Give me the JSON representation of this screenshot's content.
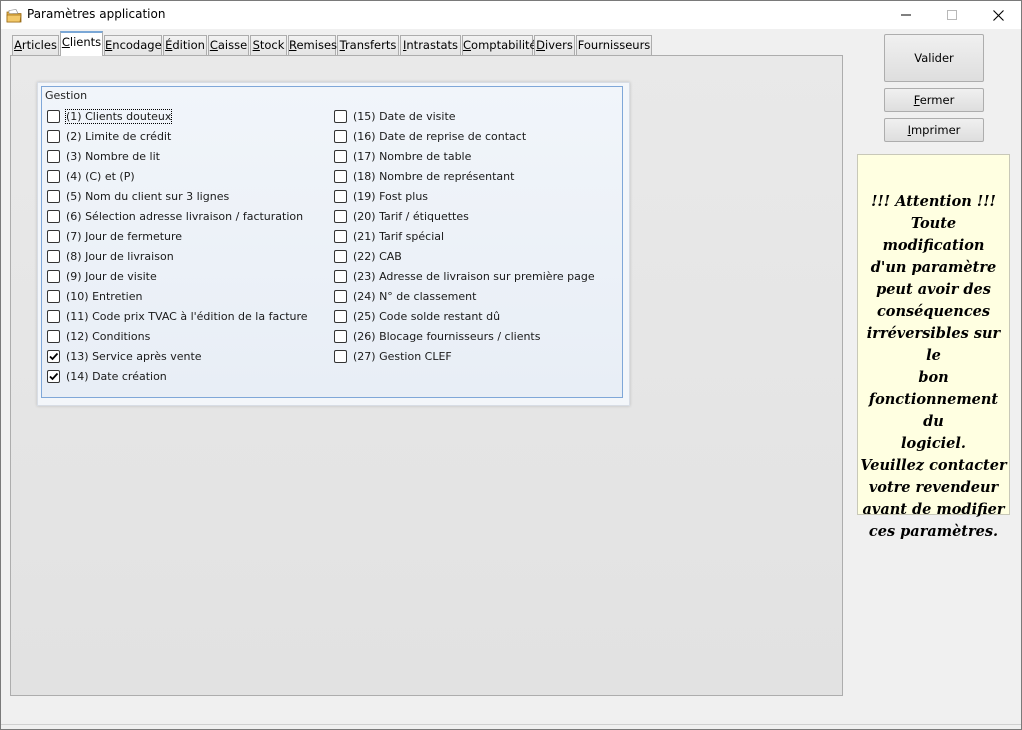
{
  "window": {
    "title": "Paramètres application",
    "icon": "folder-icon",
    "controls": [
      "minimize",
      "maximize",
      "close"
    ]
  },
  "tabs": [
    {
      "label": "Articles",
      "mnemonic": "A",
      "active": false
    },
    {
      "label": "Clients",
      "mnemonic": "C",
      "active": true
    },
    {
      "label": "Encodage",
      "mnemonic": "E",
      "active": false
    },
    {
      "label": "Édition",
      "mnemonic": "É",
      "active": false
    },
    {
      "label": "Caisse",
      "mnemonic": "C",
      "active": false
    },
    {
      "label": "Stock",
      "mnemonic": "S",
      "active": false
    },
    {
      "label": "Remises",
      "mnemonic": "R",
      "active": false
    },
    {
      "label": "Transferts",
      "mnemonic": "T",
      "active": false
    },
    {
      "label": "Intrastats",
      "mnemonic": "I",
      "active": false
    },
    {
      "label": "Comptabilité",
      "mnemonic": "C",
      "active": false
    },
    {
      "label": "Divers",
      "mnemonic": "D",
      "active": false
    },
    {
      "label": "Fournisseurs",
      "mnemonic": "",
      "active": false
    }
  ],
  "gestion": {
    "title": "Gestion",
    "left": [
      {
        "label": "(1) Clients douteux",
        "checked": false,
        "focused": true
      },
      {
        "label": "(2) Limite de crédit",
        "checked": false
      },
      {
        "label": "(3) Nombre de lit",
        "checked": false
      },
      {
        "label": "(4) (C) et (P)",
        "checked": false
      },
      {
        "label": "(5) Nom du client sur 3 lignes",
        "checked": false
      },
      {
        "label": "(6) Sélection adresse livraison / facturation",
        "checked": false
      },
      {
        "label": "(7) Jour de fermeture",
        "checked": false
      },
      {
        "label": "(8) Jour de livraison",
        "checked": false
      },
      {
        "label": "(9) Jour de visite",
        "checked": false
      },
      {
        "label": "(10) Entretien",
        "checked": false
      },
      {
        "label": "(11) Code prix TVAC à l'édition de la facture",
        "checked": false
      },
      {
        "label": "(12) Conditions",
        "checked": false
      },
      {
        "label": "(13) Service après vente",
        "checked": true
      },
      {
        "label": "(14) Date création",
        "checked": true
      }
    ],
    "right": [
      {
        "label": "(15) Date de visite",
        "checked": false
      },
      {
        "label": "(16) Date de reprise de contact",
        "checked": false
      },
      {
        "label": "(17) Nombre de table",
        "checked": false
      },
      {
        "label": "(18) Nombre de représentant",
        "checked": false
      },
      {
        "label": "(19) Fost plus",
        "checked": false
      },
      {
        "label": "(20) Tarif / étiquettes",
        "checked": false
      },
      {
        "label": "(21) Tarif spécial",
        "checked": false
      },
      {
        "label": "(22) CAB",
        "checked": false
      },
      {
        "label": "(23) Adresse de livraison sur première page",
        "checked": false
      },
      {
        "label": "(24) N° de classement",
        "checked": false
      },
      {
        "label": "(25) Code solde restant dû",
        "checked": false
      },
      {
        "label": "(26) Blocage fournisseurs / clients",
        "checked": false
      },
      {
        "label": "(27) Gestion CLEF",
        "checked": false
      }
    ]
  },
  "buttons": {
    "validate": "Valider",
    "close": "Fermer",
    "close_mnemonic": "F",
    "print": "Imprimer",
    "print_mnemonic": "I"
  },
  "warning": {
    "text": "!!! Attention !!!\nToute modification\nd'un paramètre\npeut avoir des\nconséquences\nirréversibles sur le\nbon\nfonctionnement du\nlogiciel.\nVeuillez contacter\nvotre revendeur\navant de modifier\nces paramètres."
  },
  "colors": {
    "accent": "#7fa7d8",
    "warning_bg": "#ffffe1",
    "window_bg": "#f0f0f0"
  }
}
